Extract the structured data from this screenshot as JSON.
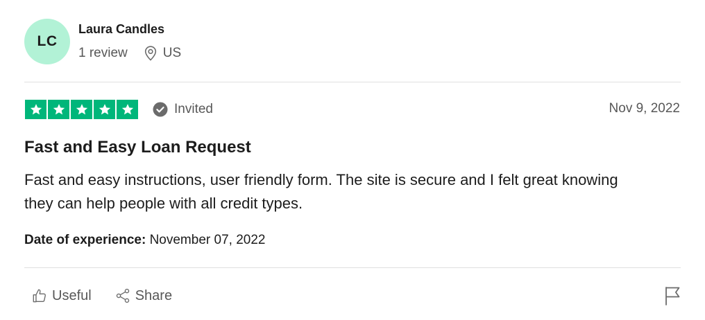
{
  "reviewer": {
    "initials": "LC",
    "name": "Laura Candles",
    "review_count": "1 review",
    "country": "US",
    "avatar_color": "#b2f2d6"
  },
  "review": {
    "rating": 5,
    "rating_max": 5,
    "star_color": "#00b67a",
    "status": "Invited",
    "date": "Nov 9, 2022",
    "title": "Fast and Easy Loan Request",
    "body": "Fast and easy instructions, user friendly form. The site is secure and I felt great knowing they can help people with all credit types.",
    "experience_label": "Date of experience:",
    "experience_date": "November 07, 2022"
  },
  "actions": {
    "useful_label": "Useful",
    "share_label": "Share"
  },
  "icons": {
    "location": "location-pin-icon",
    "verified": "check-circle-icon",
    "useful": "thumbs-up-icon",
    "share": "share-icon",
    "report": "flag-icon"
  }
}
